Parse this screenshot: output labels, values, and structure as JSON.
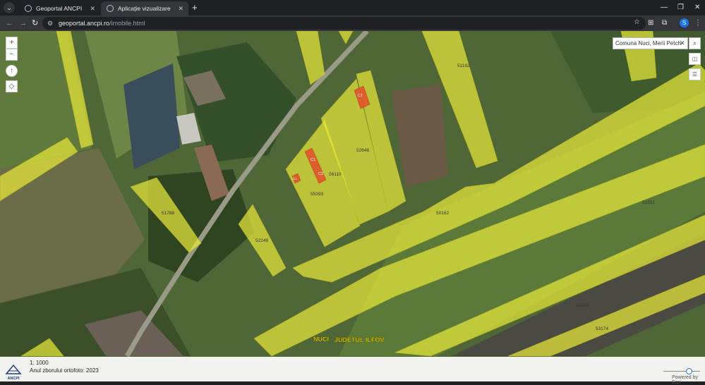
{
  "browser": {
    "tabs": [
      {
        "title": "Geoportal ANCPI",
        "active": false
      },
      {
        "title": "Aplicație vizualizare imobile",
        "active": true
      }
    ],
    "url_domain": "geoportal.ancpi.ro",
    "url_path": "/imobile.html",
    "profile_initial": "S",
    "icons": {
      "tab_menu": "chevron-down-icon",
      "new_tab": "plus-icon",
      "minimize": "minimize-icon",
      "restore": "restore-icon",
      "close": "close-icon",
      "back": "arrow-left-icon",
      "forward": "arrow-right-icon",
      "reload": "reload-icon",
      "site_info": "tune-icon",
      "bookmark": "star-icon",
      "extensions": "puzzle-icon",
      "menu": "kebab-menu-icon"
    }
  },
  "map": {
    "parcel_labels": [
      "51182",
      "52648",
      "56110",
      "55393",
      "51788",
      "52249",
      "50162",
      "51551",
      "51552",
      "53174"
    ],
    "building_labels": [
      "C1",
      "C1",
      "C2",
      "C1"
    ],
    "place_labels": {
      "town": "NUCI",
      "county": "JUDEȚUL ILFOV"
    },
    "colors": {
      "parcel_fill": "#e8e83a",
      "building_fill": "#e0542c",
      "place_label": "#f5e000"
    },
    "controls": {
      "zoom_in": "+",
      "zoom_out": "−",
      "compass_icon": "north-arrow-icon",
      "locate_icon": "locate-icon"
    },
    "search": {
      "value": "Comuna Nuci, Merii Petch",
      "clear_icon": "close-icon",
      "button_icon": "search-icon"
    },
    "right_tools": {
      "layers_icon": "layers-icon",
      "legend_icon": "list-icon"
    }
  },
  "footer": {
    "logo_text": "ANCPI",
    "scale_text": "1: 1000",
    "orthophoto_year": "Anul zborului ortofoto: 2023",
    "powered_by": "Powered by Esri"
  }
}
